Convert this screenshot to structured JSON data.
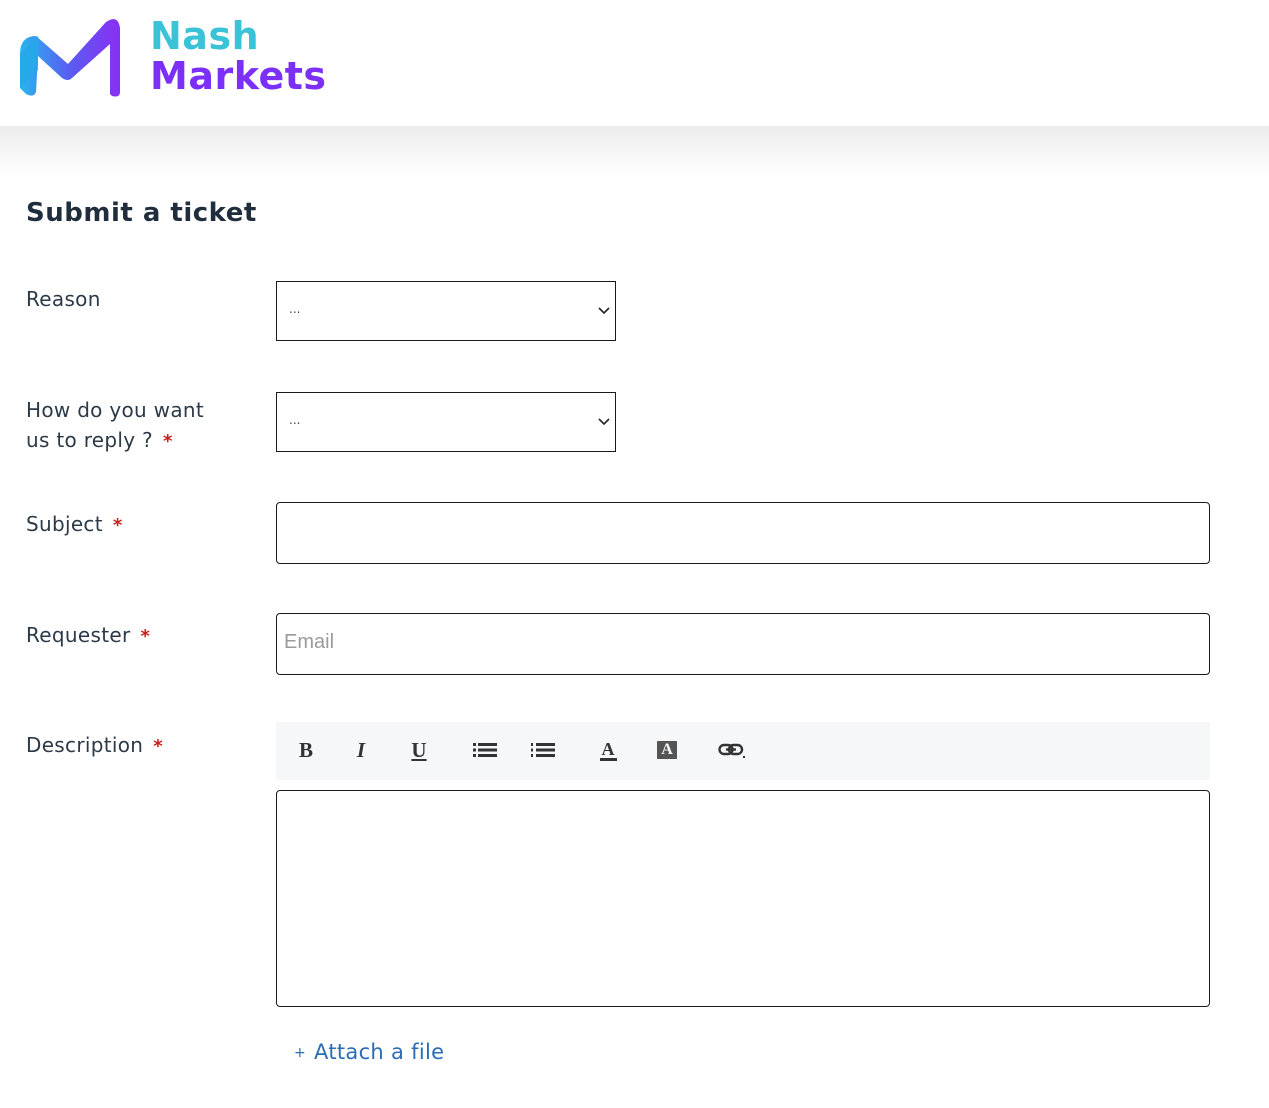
{
  "brand": {
    "line1": "Nash",
    "line2": "Markets"
  },
  "page_title": "Submit a ticket",
  "form": {
    "reason": {
      "label": "Reason",
      "value": "..."
    },
    "reply": {
      "label_line1": "How do you want",
      "label_line2": "us to reply ?",
      "required_mark": "*",
      "value": "..."
    },
    "subject": {
      "label": "Subject",
      "required_mark": "*",
      "value": ""
    },
    "requester": {
      "label": "Requester",
      "required_mark": "*",
      "placeholder": "Email"
    },
    "description": {
      "label": "Description",
      "required_mark": "*",
      "toolbar": {
        "bold": "B",
        "italic": "I",
        "underline": "U",
        "font_color": "A",
        "highlight": "A"
      }
    },
    "attach": {
      "plus": "+",
      "label": "Attach a file"
    }
  },
  "colors": {
    "brand_cyan": "#3ac3d6",
    "brand_purple": "#7b2ff7",
    "required": "#c81e1e",
    "link": "#2a6db5"
  }
}
